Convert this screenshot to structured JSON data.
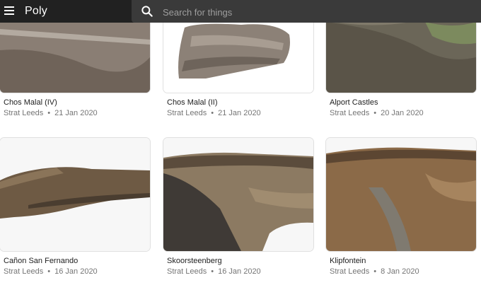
{
  "app": {
    "name": "Poly"
  },
  "search": {
    "placeholder": "Search for things"
  },
  "cards": [
    {
      "title": "Chos Malal (IV)",
      "author": "Strat Leeds",
      "date": "21 Jan 2020"
    },
    {
      "title": "Chos Malal (II)",
      "author": "Strat Leeds",
      "date": "21 Jan 2020"
    },
    {
      "title": "Alport Castles",
      "author": "Strat Leeds",
      "date": "20 Jan 2020"
    },
    {
      "title": "Cañon San Fernando",
      "author": "Strat Leeds",
      "date": "16 Jan 2020"
    },
    {
      "title": "Skoorsteenberg",
      "author": "Strat Leeds",
      "date": "16 Jan 2020"
    },
    {
      "title": "Klipfontein",
      "author": "Strat Leeds",
      "date": "8 Jan 2020"
    }
  ]
}
